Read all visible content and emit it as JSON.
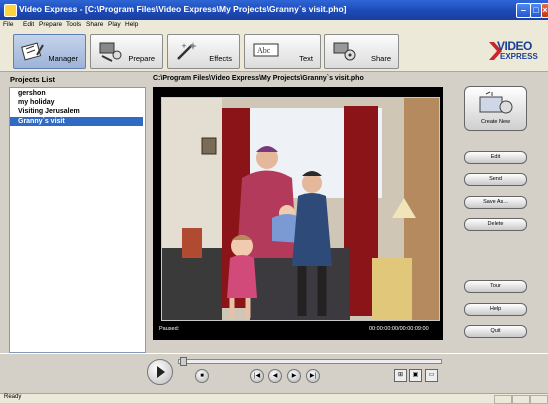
{
  "window": {
    "title": "Video Express - [C:\\Program Files\\Video Express\\My Projects\\Granny`s visit.pho]",
    "controls": {
      "minimize": "–",
      "maximize": "□",
      "close": "×"
    }
  },
  "menu": [
    "File",
    "Edit",
    "Prepare",
    "Tools",
    "Share",
    "Play",
    "Help"
  ],
  "toolbar": {
    "tabs": [
      {
        "label": "Manager",
        "icon": "manager-icon"
      },
      {
        "label": "Prepare",
        "icon": "prepare-icon"
      },
      {
        "label": "Effects",
        "icon": "effects-icon"
      },
      {
        "label": "Text",
        "icon": "text-icon"
      },
      {
        "label": "Share",
        "icon": "share-icon"
      }
    ],
    "active_tab": "Manager",
    "logo_line1": "VIDEO",
    "logo_line2": "EXPRESS"
  },
  "projects": {
    "header": "Projects List",
    "items": [
      "gershon",
      "my holiday",
      "Visiting Jerusalem",
      "Granny`s visit"
    ],
    "selected": "Granny`s visit"
  },
  "player": {
    "path": "C:\\Program Files\\Video Express\\My Projects\\Granny`s visit.pho",
    "status": "Paused:",
    "time": "00:00:00:00/00:00:09:00"
  },
  "side_buttons": {
    "create_new": "Create New",
    "edit": "Edit",
    "send": "Send",
    "save_as": "Save As...",
    "delete": "Delete",
    "tour": "Tour",
    "help": "Help",
    "quit": "Quit"
  },
  "statusbar": {
    "text": "Ready"
  },
  "colors": {
    "titlebar": "#2f66d6",
    "selection": "#316ac5",
    "player_bg": "#000000"
  }
}
